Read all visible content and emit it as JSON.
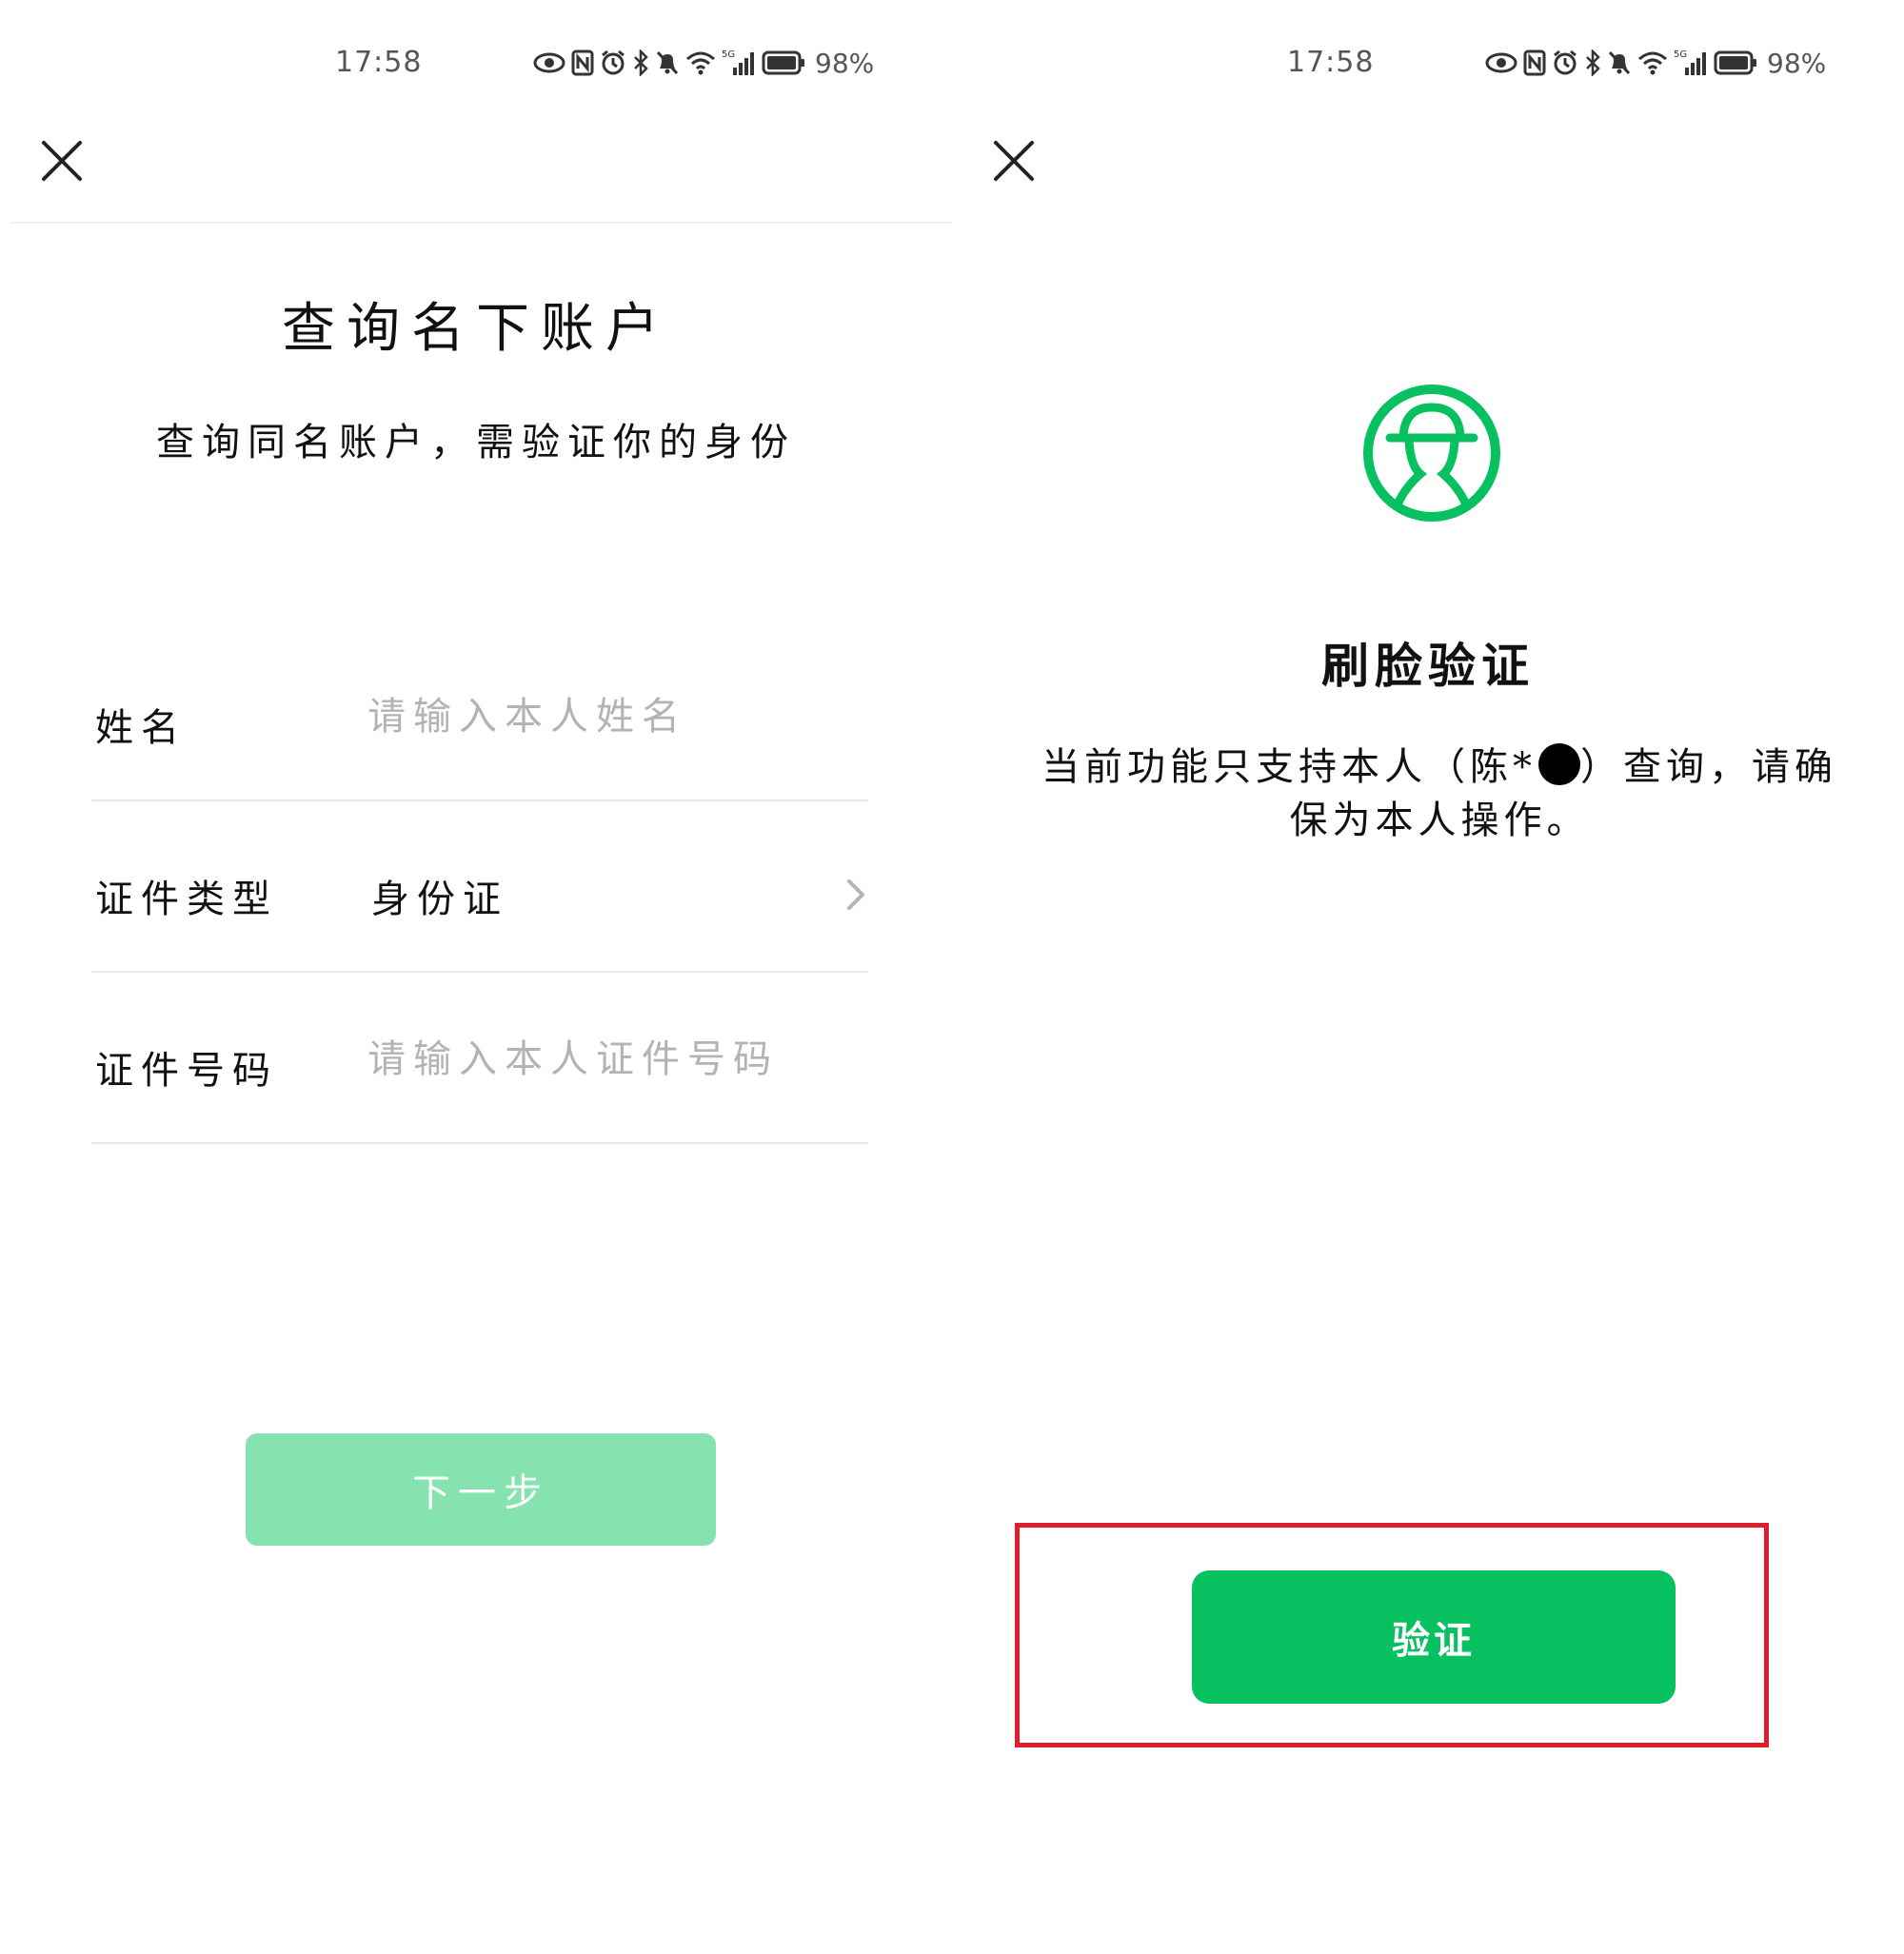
{
  "colors": {
    "accent_green": "#07c160",
    "disabled_green": "#86e3b0",
    "highlight_red": "#e01d2e"
  },
  "status_bar": {
    "time": "17:58",
    "network_badge": "5G",
    "battery": "98%",
    "icons": [
      "eye-icon",
      "nfc-icon",
      "alarm-icon",
      "bluetooth-icon",
      "bell-muted-icon",
      "wifi-icon",
      "signal-icon",
      "battery-icon"
    ]
  },
  "left": {
    "title": "查询名下账户",
    "subtitle": "查询同名账户，需验证你的身份",
    "form": {
      "name_label": "姓名",
      "name_placeholder": "请输入本人姓名",
      "id_type_label": "证件类型",
      "id_type_value": "身份证",
      "id_number_label": "证件号码",
      "id_number_placeholder": "请输入本人证件号码"
    },
    "next_button": "下一步"
  },
  "right": {
    "title": "刷脸验证",
    "notice_prefix": "当前功能只支持本人（陈*",
    "notice_suffix": "）查询，请确保为本人操作。",
    "verify_button": "验证"
  }
}
